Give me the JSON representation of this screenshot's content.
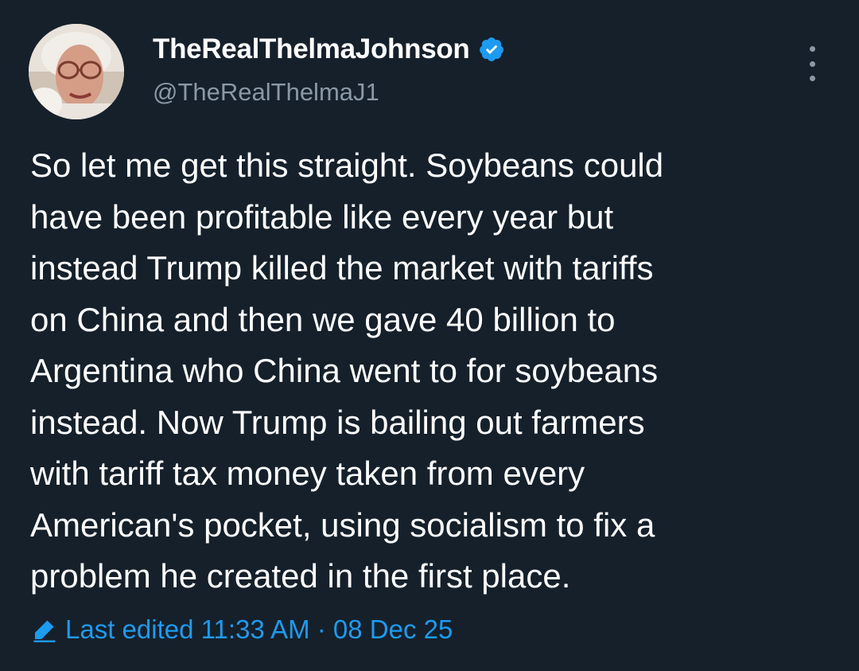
{
  "author": {
    "display_name": "TheRealThelmaJohnson",
    "handle": "@TheRealThelmaJ1",
    "verified": true,
    "avatar_icon": "profile-photo"
  },
  "tweet": {
    "lines": [
      "So let me get this straight.  Soybeans could",
      "have been profitable like every year but",
      "instead Trump killed the market with tariffs",
      "on China and then we gave 40 billion  to",
      "Argentina who China went to for soybeans",
      "instead.  Now Trump is bailing out farmers",
      "with tariff tax money taken from every",
      "American's pocket, using socialism to fix a",
      "problem he created in the first place."
    ]
  },
  "footer": {
    "edited_label": "Last edited 11:33 AM · 08 Dec 25",
    "icon": "pencil-icon"
  },
  "menu": {
    "icon": "more-vertical-icon"
  },
  "colors": {
    "background": "#15202b",
    "text": "#ffffff",
    "secondary": "#8b98a5",
    "accent": "#1d9bf0"
  }
}
